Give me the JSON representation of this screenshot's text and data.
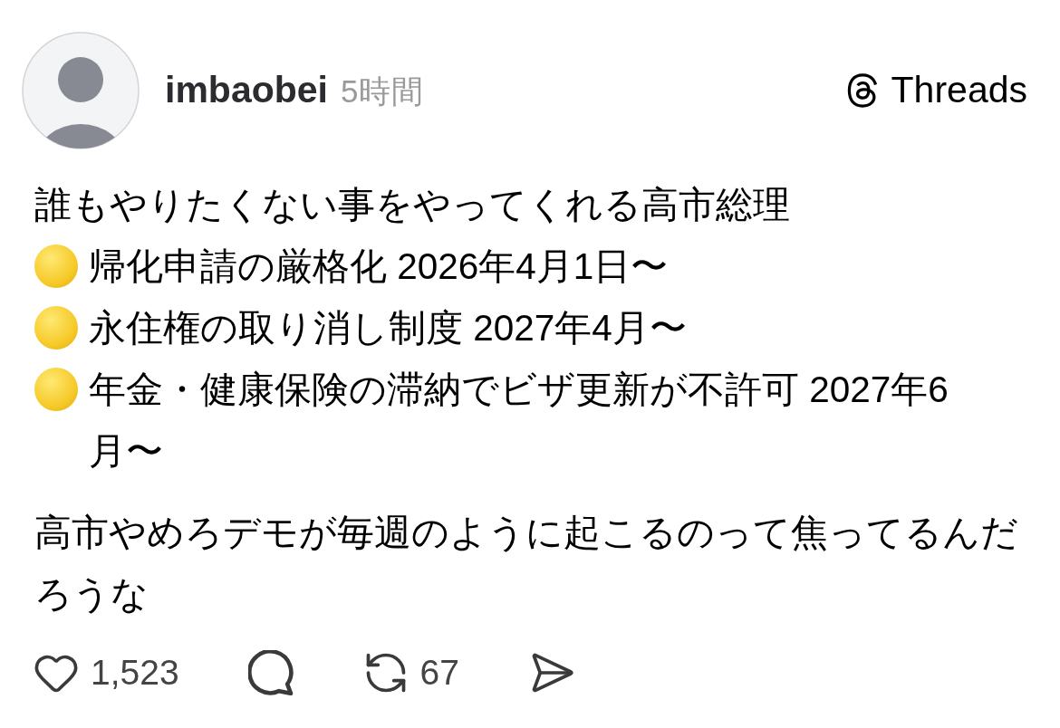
{
  "post": {
    "author": {
      "username": "imbaobei",
      "time": "5時間"
    },
    "brand": {
      "name": "Threads"
    },
    "paragraphs": [
      {
        "lines": [
          {
            "kind": "plain",
            "text": "誰もやりたくない事をやってくれる高市総理"
          },
          {
            "kind": "bullet",
            "text": "帰化申請の厳格化 2026年4月1日〜"
          },
          {
            "kind": "bullet",
            "text": "永住権の取り消し制度 2027年4月〜"
          },
          {
            "kind": "bullet",
            "text": "年金・健康保険の滞納でビザ更新が不許可 2027年6月〜"
          }
        ]
      },
      {
        "lines": [
          {
            "kind": "plain",
            "text": "高市やめろデモが毎週のように起こるのって焦ってるんだろうな"
          }
        ]
      }
    ],
    "actions": [
      {
        "kind": "like",
        "count": "1,523"
      },
      {
        "kind": "reply"
      },
      {
        "kind": "repost",
        "count": "67"
      },
      {
        "kind": "share"
      }
    ]
  }
}
